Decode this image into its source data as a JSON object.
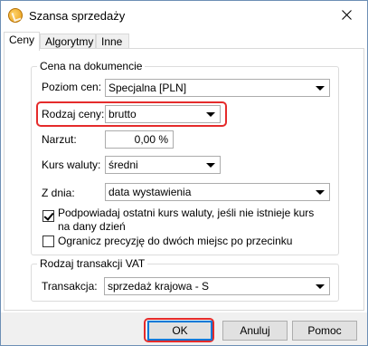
{
  "window": {
    "title": "Szansa sprzedaży"
  },
  "tabs": [
    {
      "label": "Ceny",
      "active": true
    },
    {
      "label": "Algorytmy",
      "active": false
    },
    {
      "label": "Inne",
      "active": false
    }
  ],
  "price_group": {
    "legend": "Cena na dokumencie",
    "price_level": {
      "label": "Poziom cen:",
      "value": "Specjalna [PLN]"
    },
    "price_type": {
      "label": "Rodzaj ceny:",
      "value": "brutto"
    },
    "markup": {
      "label": "Narzut:",
      "value": "0,00 %"
    },
    "exchange_rate": {
      "label": "Kurs waluty:",
      "value": "średni"
    },
    "from_date": {
      "label": "Z dnia:",
      "value": "data wystawienia"
    },
    "suggest_rate": {
      "label": "Podpowiadaj ostatni kurs waluty, jeśli nie istnieje kurs na dany dzień",
      "checked": true
    },
    "limit_precision": {
      "label": "Ogranicz precyzję do dwóch miejsc po przecinku",
      "checked": false
    }
  },
  "vat_group": {
    "legend": "Rodzaj transakcji VAT",
    "transaction": {
      "label": "Transakcja:",
      "value": "sprzedaż krajowa - S"
    }
  },
  "buttons": {
    "ok": "OK",
    "cancel": "Anuluj",
    "help": "Pomoc"
  },
  "colors": {
    "highlight": "#e52b2b",
    "window_border": "#6d8fb5",
    "footer_bg": "#f0f0f0"
  }
}
